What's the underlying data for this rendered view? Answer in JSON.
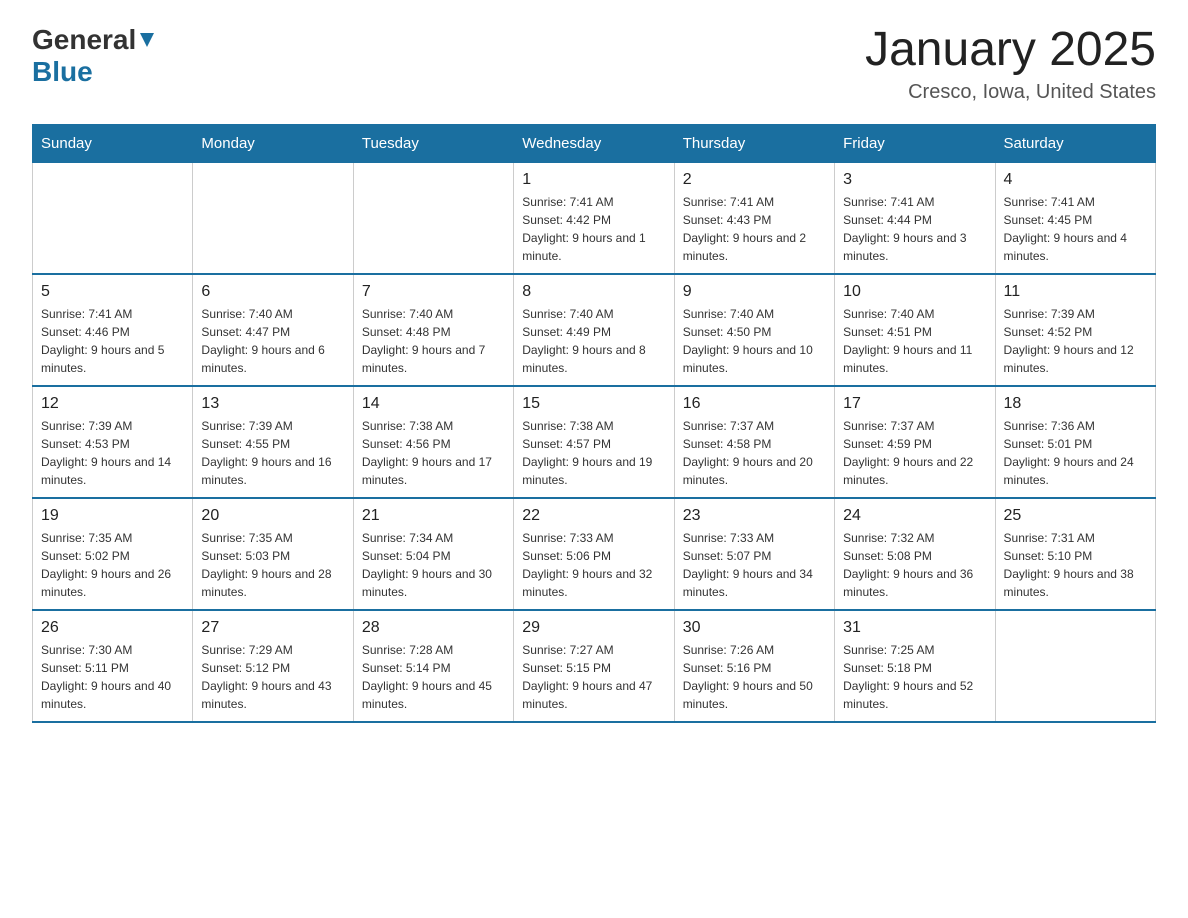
{
  "header": {
    "logo_general": "General",
    "logo_blue": "Blue",
    "month_title": "January 2025",
    "location": "Cresco, Iowa, United States"
  },
  "weekdays": [
    "Sunday",
    "Monday",
    "Tuesday",
    "Wednesday",
    "Thursday",
    "Friday",
    "Saturday"
  ],
  "weeks": [
    [
      {
        "day": "",
        "info": ""
      },
      {
        "day": "",
        "info": ""
      },
      {
        "day": "",
        "info": ""
      },
      {
        "day": "1",
        "info": "Sunrise: 7:41 AM\nSunset: 4:42 PM\nDaylight: 9 hours and 1 minute."
      },
      {
        "day": "2",
        "info": "Sunrise: 7:41 AM\nSunset: 4:43 PM\nDaylight: 9 hours and 2 minutes."
      },
      {
        "day": "3",
        "info": "Sunrise: 7:41 AM\nSunset: 4:44 PM\nDaylight: 9 hours and 3 minutes."
      },
      {
        "day": "4",
        "info": "Sunrise: 7:41 AM\nSunset: 4:45 PM\nDaylight: 9 hours and 4 minutes."
      }
    ],
    [
      {
        "day": "5",
        "info": "Sunrise: 7:41 AM\nSunset: 4:46 PM\nDaylight: 9 hours and 5 minutes."
      },
      {
        "day": "6",
        "info": "Sunrise: 7:40 AM\nSunset: 4:47 PM\nDaylight: 9 hours and 6 minutes."
      },
      {
        "day": "7",
        "info": "Sunrise: 7:40 AM\nSunset: 4:48 PM\nDaylight: 9 hours and 7 minutes."
      },
      {
        "day": "8",
        "info": "Sunrise: 7:40 AM\nSunset: 4:49 PM\nDaylight: 9 hours and 8 minutes."
      },
      {
        "day": "9",
        "info": "Sunrise: 7:40 AM\nSunset: 4:50 PM\nDaylight: 9 hours and 10 minutes."
      },
      {
        "day": "10",
        "info": "Sunrise: 7:40 AM\nSunset: 4:51 PM\nDaylight: 9 hours and 11 minutes."
      },
      {
        "day": "11",
        "info": "Sunrise: 7:39 AM\nSunset: 4:52 PM\nDaylight: 9 hours and 12 minutes."
      }
    ],
    [
      {
        "day": "12",
        "info": "Sunrise: 7:39 AM\nSunset: 4:53 PM\nDaylight: 9 hours and 14 minutes."
      },
      {
        "day": "13",
        "info": "Sunrise: 7:39 AM\nSunset: 4:55 PM\nDaylight: 9 hours and 16 minutes."
      },
      {
        "day": "14",
        "info": "Sunrise: 7:38 AM\nSunset: 4:56 PM\nDaylight: 9 hours and 17 minutes."
      },
      {
        "day": "15",
        "info": "Sunrise: 7:38 AM\nSunset: 4:57 PM\nDaylight: 9 hours and 19 minutes."
      },
      {
        "day": "16",
        "info": "Sunrise: 7:37 AM\nSunset: 4:58 PM\nDaylight: 9 hours and 20 minutes."
      },
      {
        "day": "17",
        "info": "Sunrise: 7:37 AM\nSunset: 4:59 PM\nDaylight: 9 hours and 22 minutes."
      },
      {
        "day": "18",
        "info": "Sunrise: 7:36 AM\nSunset: 5:01 PM\nDaylight: 9 hours and 24 minutes."
      }
    ],
    [
      {
        "day": "19",
        "info": "Sunrise: 7:35 AM\nSunset: 5:02 PM\nDaylight: 9 hours and 26 minutes."
      },
      {
        "day": "20",
        "info": "Sunrise: 7:35 AM\nSunset: 5:03 PM\nDaylight: 9 hours and 28 minutes."
      },
      {
        "day": "21",
        "info": "Sunrise: 7:34 AM\nSunset: 5:04 PM\nDaylight: 9 hours and 30 minutes."
      },
      {
        "day": "22",
        "info": "Sunrise: 7:33 AM\nSunset: 5:06 PM\nDaylight: 9 hours and 32 minutes."
      },
      {
        "day": "23",
        "info": "Sunrise: 7:33 AM\nSunset: 5:07 PM\nDaylight: 9 hours and 34 minutes."
      },
      {
        "day": "24",
        "info": "Sunrise: 7:32 AM\nSunset: 5:08 PM\nDaylight: 9 hours and 36 minutes."
      },
      {
        "day": "25",
        "info": "Sunrise: 7:31 AM\nSunset: 5:10 PM\nDaylight: 9 hours and 38 minutes."
      }
    ],
    [
      {
        "day": "26",
        "info": "Sunrise: 7:30 AM\nSunset: 5:11 PM\nDaylight: 9 hours and 40 minutes."
      },
      {
        "day": "27",
        "info": "Sunrise: 7:29 AM\nSunset: 5:12 PM\nDaylight: 9 hours and 43 minutes."
      },
      {
        "day": "28",
        "info": "Sunrise: 7:28 AM\nSunset: 5:14 PM\nDaylight: 9 hours and 45 minutes."
      },
      {
        "day": "29",
        "info": "Sunrise: 7:27 AM\nSunset: 5:15 PM\nDaylight: 9 hours and 47 minutes."
      },
      {
        "day": "30",
        "info": "Sunrise: 7:26 AM\nSunset: 5:16 PM\nDaylight: 9 hours and 50 minutes."
      },
      {
        "day": "31",
        "info": "Sunrise: 7:25 AM\nSunset: 5:18 PM\nDaylight: 9 hours and 52 minutes."
      },
      {
        "day": "",
        "info": ""
      }
    ]
  ],
  "colors": {
    "header_bg": "#1a6fa0",
    "border_blue": "#1a6fa0",
    "text_dark": "#222",
    "text_mid": "#333",
    "text_light": "#555"
  }
}
